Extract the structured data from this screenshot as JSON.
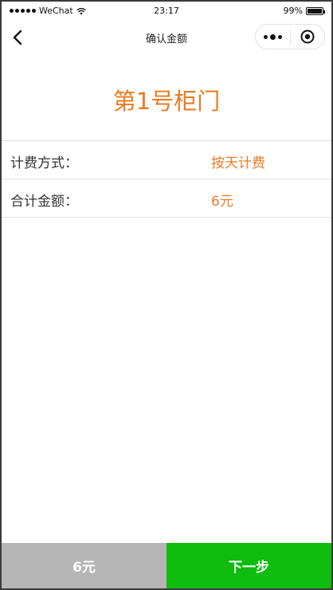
{
  "status_bar": {
    "carrier": "WeChat",
    "time": "23:17",
    "battery": "99%",
    "battery_level": 0.99
  },
  "nav": {
    "title": "确认金额",
    "back_icon": "chevron-left-icon",
    "more_icon": "more-dots-icon",
    "close_icon": "target-close-icon"
  },
  "door": {
    "title": "第1号柜门"
  },
  "info_rows": [
    {
      "label": "计费方式：",
      "value": "按天计费"
    },
    {
      "label": "合计金额：",
      "value": "6元"
    }
  ],
  "bottom": {
    "price": "6元",
    "next_label": "下一步"
  },
  "colors": {
    "accent": "#e97c23",
    "primary_button": "#0dbc0d",
    "disabled_bar": "#b5b5b5",
    "divider": "#e2e2e2"
  }
}
